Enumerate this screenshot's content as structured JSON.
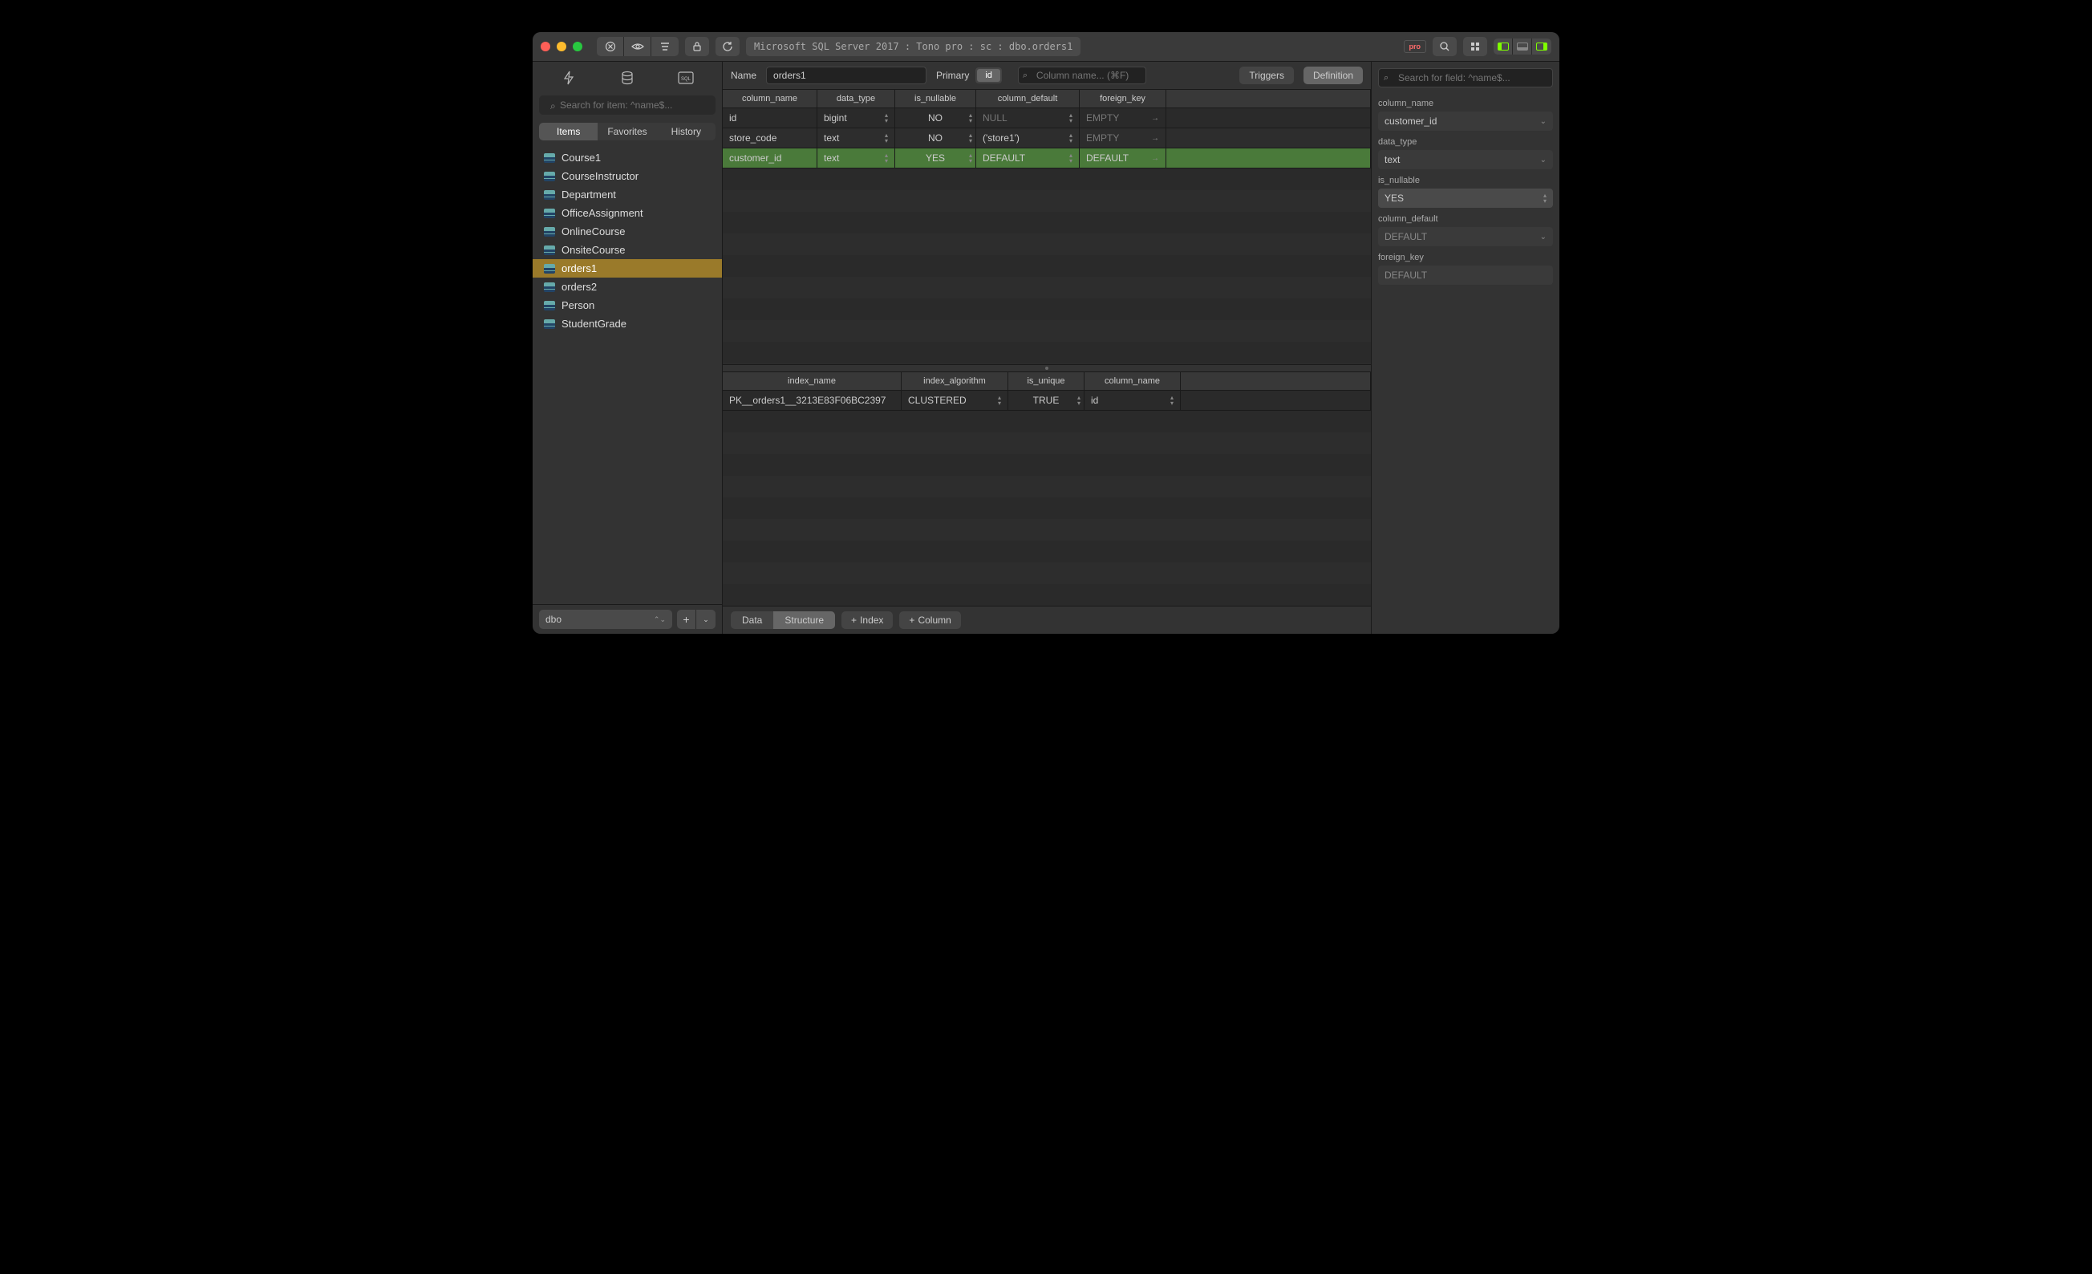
{
  "titlebar": {
    "breadcrumb": "Microsoft SQL Server 2017 : Tono pro : sc : dbo.orders1",
    "pro": "pro"
  },
  "sidebar": {
    "search_placeholder": "Search for item: ^name$...",
    "filters": [
      "Items",
      "Favorites",
      "History"
    ],
    "active_filter": 0,
    "items": [
      "Course1",
      "CourseInstructor",
      "Department",
      "OfficeAssignment",
      "OnlineCourse",
      "OnsiteCourse",
      "orders1",
      "orders2",
      "Person",
      "StudentGrade"
    ],
    "selected": "orders1",
    "schema": "dbo"
  },
  "editor": {
    "name_label": "Name",
    "name_value": "orders1",
    "primary_label": "Primary",
    "primary_col": "id",
    "col_search_placeholder": "Column name... (⌘F)",
    "triggers": "Triggers",
    "definition": "Definition"
  },
  "columns_grid": {
    "headers": [
      "column_name",
      "data_type",
      "is_nullable",
      "column_default",
      "foreign_key"
    ],
    "rows": [
      {
        "name": "id",
        "type": "bigint",
        "nullable": "NO",
        "default": "NULL",
        "default_dim": true,
        "fk": "EMPTY",
        "fk_dim": true
      },
      {
        "name": "store_code",
        "type": "text",
        "nullable": "NO",
        "default": "('store1')",
        "default_dim": false,
        "fk": "EMPTY",
        "fk_dim": true
      },
      {
        "name": "customer_id",
        "type": "text",
        "nullable": "YES",
        "default": "DEFAULT",
        "default_dim": true,
        "fk": "DEFAULT",
        "fk_dim": true
      }
    ],
    "selected_row": 2
  },
  "index_grid": {
    "headers": [
      "index_name",
      "index_algorithm",
      "is_unique",
      "column_name"
    ],
    "rows": [
      {
        "name": "PK__orders1__3213E83F06BC2397",
        "algo": "CLUSTERED",
        "unique": "TRUE",
        "col": "id"
      }
    ]
  },
  "bottom": {
    "data": "Data",
    "structure": "Structure",
    "index": "Index",
    "column": "Column"
  },
  "inspector": {
    "search_placeholder": "Search for field: ^name$...",
    "labels": {
      "column_name": "column_name",
      "data_type": "data_type",
      "is_nullable": "is_nullable",
      "column_default": "column_default",
      "foreign_key": "foreign_key"
    },
    "values": {
      "column_name": "customer_id",
      "data_type": "text",
      "is_nullable": "YES",
      "column_default": "DEFAULT",
      "foreign_key": "DEFAULT"
    }
  }
}
